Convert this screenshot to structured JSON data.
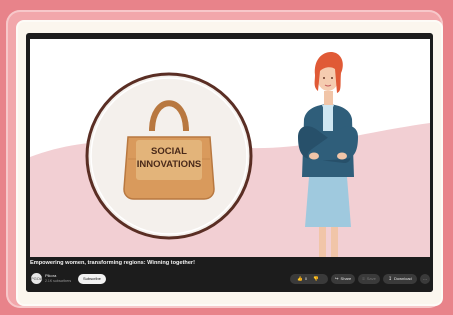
{
  "scene": {
    "sign_line1": "SOCIAL",
    "sign_line2": "INNOVATIONS"
  },
  "video": {
    "title": "Empowering women, transforming regions: Winning together!",
    "channel_avatar_text": "PGOA",
    "channel_name": "Pikora",
    "channel_subs": "2.1K subscribers",
    "subscribe_label": "Subscribe",
    "like_count": "0",
    "share_label": "Share",
    "save_label": "Save",
    "download_label": "Download",
    "more_label": "…"
  },
  "colors": {
    "page_bg": "#e8838a",
    "bag": "#d99a5c",
    "bag_label": "#e3b47a",
    "jacket": "#2f5e7a",
    "skirt": "#9fc9de",
    "hair": "#e05a36",
    "accent_circle": "#5a2e24"
  },
  "icons": [
    "thumbs-up-icon",
    "thumbs-down-icon",
    "share-icon",
    "save-icon",
    "download-icon",
    "more-icon"
  ]
}
